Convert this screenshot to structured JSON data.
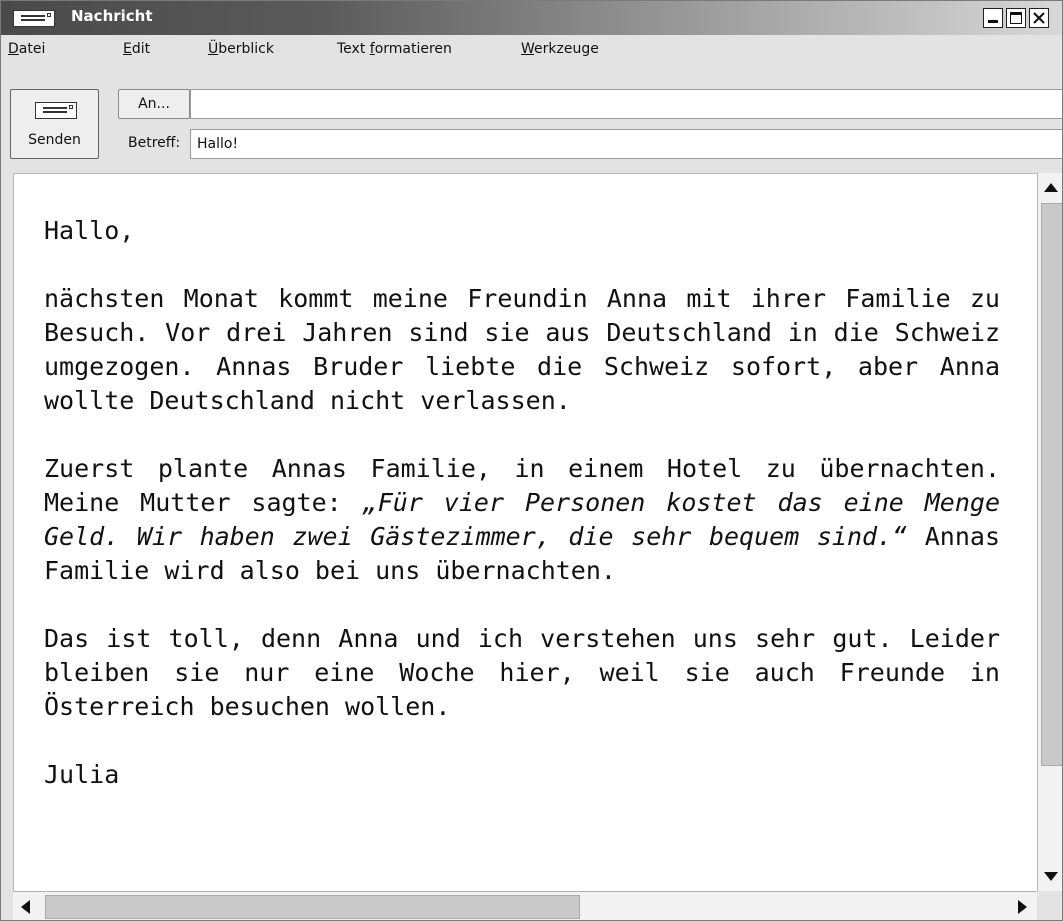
{
  "window": {
    "title": "Nachricht",
    "title_gradient": [
      "#4a4a4a",
      "#d8d8d8"
    ],
    "icons": [
      "envelope-icon",
      "minimize-icon",
      "maximize-icon",
      "close-icon"
    ]
  },
  "menu": {
    "items": [
      {
        "label": "Datei",
        "mnemonic": "D"
      },
      {
        "label": "Edit",
        "mnemonic": "E"
      },
      {
        "label": "Überblick",
        "mnemonic": "Ü"
      },
      {
        "label": "Text formatieren",
        "mnemonic": "f"
      },
      {
        "label": "Werkzeuge",
        "mnemonic": "W"
      }
    ]
  },
  "toolbar": {
    "send_label": "Senden",
    "to_button_label": "An...",
    "to_value": "",
    "subject_label": "Betreff:",
    "subject_value": "Hallo!"
  },
  "email": {
    "greeting": "Hallo,",
    "paragraph1": "nächsten Monat kommt meine Freundin Anna mit ihrer Familie zu Besuch. Vor drei Jahren sind sie aus Deutschland in die Schweiz umgezogen. Annas Bruder liebte die Schweiz sofort, aber Anna wollte Deutschland nicht verlassen.",
    "paragraph2_start": "Zuerst plante Annas Familie, in einem Hotel zu übernachten. Meine Mutter sagte: ",
    "paragraph2_quote": "„Für vier Personen kostet das eine Menge Geld. Wir haben zwei Gästezimmer, die sehr bequem sind.“",
    "paragraph2_end": " Annas Familie wird also bei uns übernachten.",
    "paragraph3": "Das ist toll, denn Anna und ich verstehen uns sehr gut. Leider bleiben sie nur eine Woche hier, weil sie auch Freunde in Österreich besuchen wollen.",
    "signature": "Julia"
  }
}
